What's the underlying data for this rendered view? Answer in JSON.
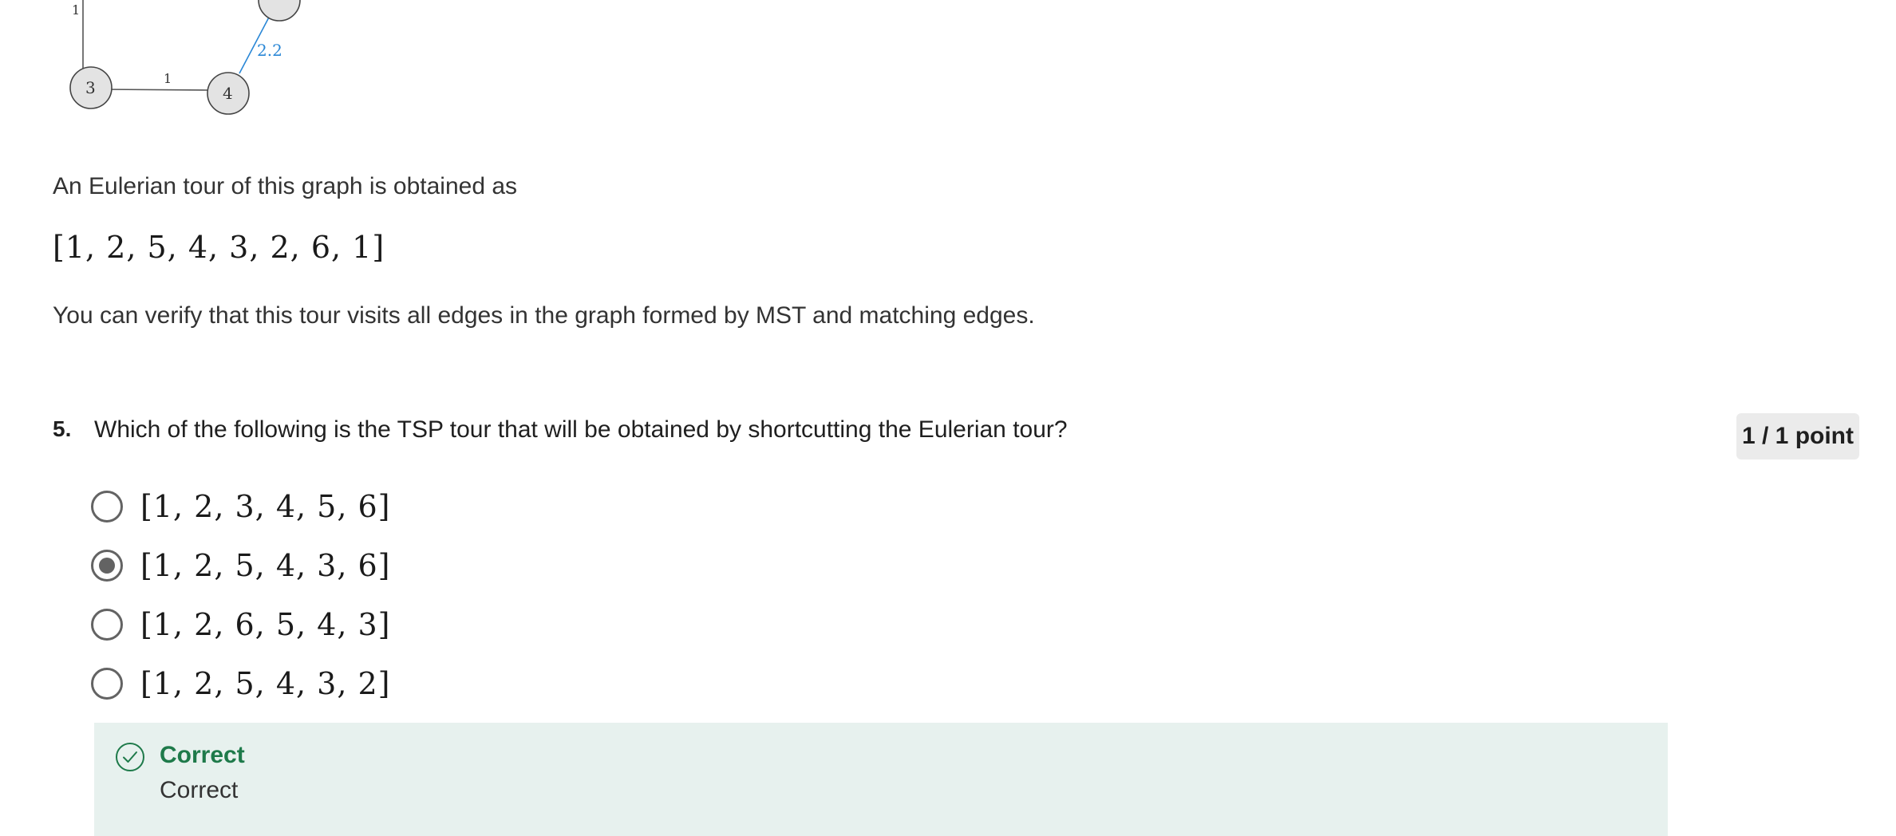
{
  "graph": {
    "nodes": [
      "3",
      "4"
    ],
    "edge_labels": [
      "1",
      "1",
      "2.2"
    ]
  },
  "explanation": {
    "line1": "An Eulerian tour of this graph is obtained as",
    "tour": "[1, 2, 5, 4, 3, 2, 6, 1]",
    "line2": "You can verify that this tour visits all edges in the graph formed by MST and matching edges."
  },
  "question": {
    "number": "5.",
    "text": "Which of the following is the TSP tour that will be obtained by shortcutting the Eulerian tour?",
    "points": "1 / 1 point",
    "options": [
      {
        "label": "[1, 2, 3, 4, 5, 6]",
        "selected": false
      },
      {
        "label": "[1, 2, 5, 4, 3, 6]",
        "selected": true
      },
      {
        "label": "[1, 2, 6, 5, 4, 3]",
        "selected": false
      },
      {
        "label": "[1, 2, 5, 4, 3, 2]",
        "selected": false
      }
    ]
  },
  "feedback": {
    "status": "Correct",
    "message": "Correct",
    "icon": "check-circle-icon",
    "color": "#1e7a4a",
    "background": "#e7f1ee"
  }
}
